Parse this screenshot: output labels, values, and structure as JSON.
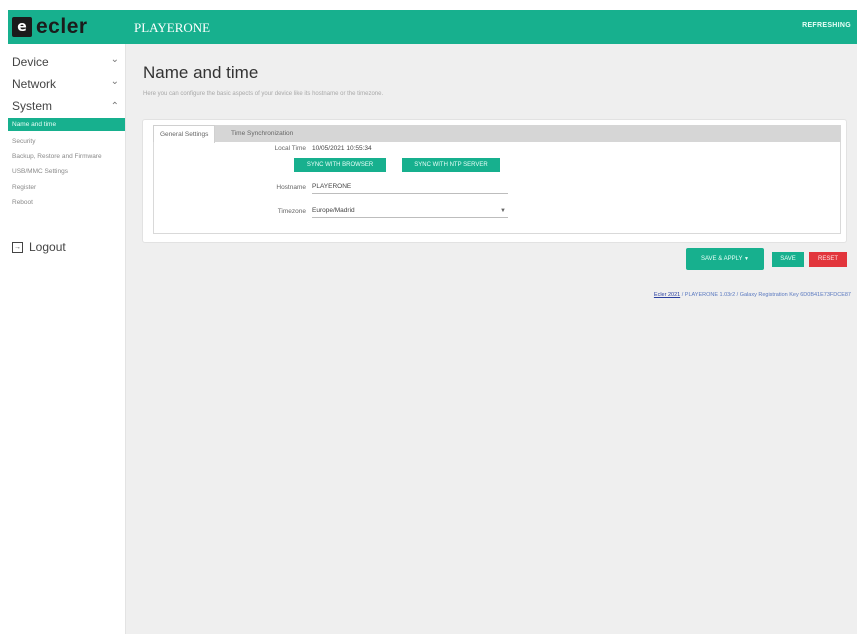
{
  "header": {
    "logo_mark": "e",
    "logo_text": "ecler",
    "app_title": "PLAYERONE",
    "refresh_label": "REFRESHING"
  },
  "colors": {
    "accent": "#17b08e",
    "reset": "#e2353c"
  },
  "sidebar": {
    "device": "Device",
    "network": "Network",
    "system": "System",
    "system_items": [
      "Name and time",
      "Security",
      "Backup, Restore and Firmware",
      "USB/MMC Settings",
      "Register",
      "Reboot"
    ],
    "logout": "Logout"
  },
  "main": {
    "title": "Name and time",
    "subtitle": "Here you can configure the basic aspects of your device like its hostname or the timezone.",
    "tabs": [
      "General Settings",
      "Time Synchronization"
    ],
    "local_time_label": "Local Time",
    "local_time_value": "10/05/2021 10:55:34",
    "sync_browser": "SYNC WITH BROWSER",
    "sync_ntp": "SYNC WITH NTP SERVER",
    "hostname_label": "Hostname",
    "hostname_value": "PLAYERONE",
    "timezone_label": "Timezone",
    "timezone_value": "Europe/Madrid"
  },
  "actions": {
    "save_apply": "SAVE & APPLY",
    "save": "SAVE",
    "reset": "RESET"
  },
  "footer": {
    "link": "Ecler 2021",
    "text": "/ PLAYERONE 1.03r2 / Galaxy Registration Key 6D0B41E73FDCE87"
  }
}
